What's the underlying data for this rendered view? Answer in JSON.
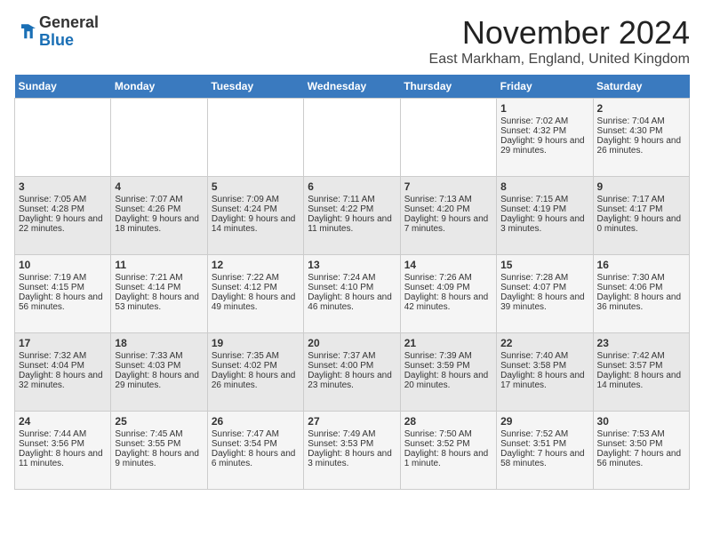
{
  "header": {
    "logo_general": "General",
    "logo_blue": "Blue",
    "month_title": "November 2024",
    "location": "East Markham, England, United Kingdom"
  },
  "days_of_week": [
    "Sunday",
    "Monday",
    "Tuesday",
    "Wednesday",
    "Thursday",
    "Friday",
    "Saturday"
  ],
  "weeks": [
    [
      {
        "num": "",
        "info": ""
      },
      {
        "num": "",
        "info": ""
      },
      {
        "num": "",
        "info": ""
      },
      {
        "num": "",
        "info": ""
      },
      {
        "num": "",
        "info": ""
      },
      {
        "num": "1",
        "info": "Sunrise: 7:02 AM\nSunset: 4:32 PM\nDaylight: 9 hours and 29 minutes."
      },
      {
        "num": "2",
        "info": "Sunrise: 7:04 AM\nSunset: 4:30 PM\nDaylight: 9 hours and 26 minutes."
      }
    ],
    [
      {
        "num": "3",
        "info": "Sunrise: 7:05 AM\nSunset: 4:28 PM\nDaylight: 9 hours and 22 minutes."
      },
      {
        "num": "4",
        "info": "Sunrise: 7:07 AM\nSunset: 4:26 PM\nDaylight: 9 hours and 18 minutes."
      },
      {
        "num": "5",
        "info": "Sunrise: 7:09 AM\nSunset: 4:24 PM\nDaylight: 9 hours and 14 minutes."
      },
      {
        "num": "6",
        "info": "Sunrise: 7:11 AM\nSunset: 4:22 PM\nDaylight: 9 hours and 11 minutes."
      },
      {
        "num": "7",
        "info": "Sunrise: 7:13 AM\nSunset: 4:20 PM\nDaylight: 9 hours and 7 minutes."
      },
      {
        "num": "8",
        "info": "Sunrise: 7:15 AM\nSunset: 4:19 PM\nDaylight: 9 hours and 3 minutes."
      },
      {
        "num": "9",
        "info": "Sunrise: 7:17 AM\nSunset: 4:17 PM\nDaylight: 9 hours and 0 minutes."
      }
    ],
    [
      {
        "num": "10",
        "info": "Sunrise: 7:19 AM\nSunset: 4:15 PM\nDaylight: 8 hours and 56 minutes."
      },
      {
        "num": "11",
        "info": "Sunrise: 7:21 AM\nSunset: 4:14 PM\nDaylight: 8 hours and 53 minutes."
      },
      {
        "num": "12",
        "info": "Sunrise: 7:22 AM\nSunset: 4:12 PM\nDaylight: 8 hours and 49 minutes."
      },
      {
        "num": "13",
        "info": "Sunrise: 7:24 AM\nSunset: 4:10 PM\nDaylight: 8 hours and 46 minutes."
      },
      {
        "num": "14",
        "info": "Sunrise: 7:26 AM\nSunset: 4:09 PM\nDaylight: 8 hours and 42 minutes."
      },
      {
        "num": "15",
        "info": "Sunrise: 7:28 AM\nSunset: 4:07 PM\nDaylight: 8 hours and 39 minutes."
      },
      {
        "num": "16",
        "info": "Sunrise: 7:30 AM\nSunset: 4:06 PM\nDaylight: 8 hours and 36 minutes."
      }
    ],
    [
      {
        "num": "17",
        "info": "Sunrise: 7:32 AM\nSunset: 4:04 PM\nDaylight: 8 hours and 32 minutes."
      },
      {
        "num": "18",
        "info": "Sunrise: 7:33 AM\nSunset: 4:03 PM\nDaylight: 8 hours and 29 minutes."
      },
      {
        "num": "19",
        "info": "Sunrise: 7:35 AM\nSunset: 4:02 PM\nDaylight: 8 hours and 26 minutes."
      },
      {
        "num": "20",
        "info": "Sunrise: 7:37 AM\nSunset: 4:00 PM\nDaylight: 8 hours and 23 minutes."
      },
      {
        "num": "21",
        "info": "Sunrise: 7:39 AM\nSunset: 3:59 PM\nDaylight: 8 hours and 20 minutes."
      },
      {
        "num": "22",
        "info": "Sunrise: 7:40 AM\nSunset: 3:58 PM\nDaylight: 8 hours and 17 minutes."
      },
      {
        "num": "23",
        "info": "Sunrise: 7:42 AM\nSunset: 3:57 PM\nDaylight: 8 hours and 14 minutes."
      }
    ],
    [
      {
        "num": "24",
        "info": "Sunrise: 7:44 AM\nSunset: 3:56 PM\nDaylight: 8 hours and 11 minutes."
      },
      {
        "num": "25",
        "info": "Sunrise: 7:45 AM\nSunset: 3:55 PM\nDaylight: 8 hours and 9 minutes."
      },
      {
        "num": "26",
        "info": "Sunrise: 7:47 AM\nSunset: 3:54 PM\nDaylight: 8 hours and 6 minutes."
      },
      {
        "num": "27",
        "info": "Sunrise: 7:49 AM\nSunset: 3:53 PM\nDaylight: 8 hours and 3 minutes."
      },
      {
        "num": "28",
        "info": "Sunrise: 7:50 AM\nSunset: 3:52 PM\nDaylight: 8 hours and 1 minute."
      },
      {
        "num": "29",
        "info": "Sunrise: 7:52 AM\nSunset: 3:51 PM\nDaylight: 7 hours and 58 minutes."
      },
      {
        "num": "30",
        "info": "Sunrise: 7:53 AM\nSunset: 3:50 PM\nDaylight: 7 hours and 56 minutes."
      }
    ]
  ]
}
